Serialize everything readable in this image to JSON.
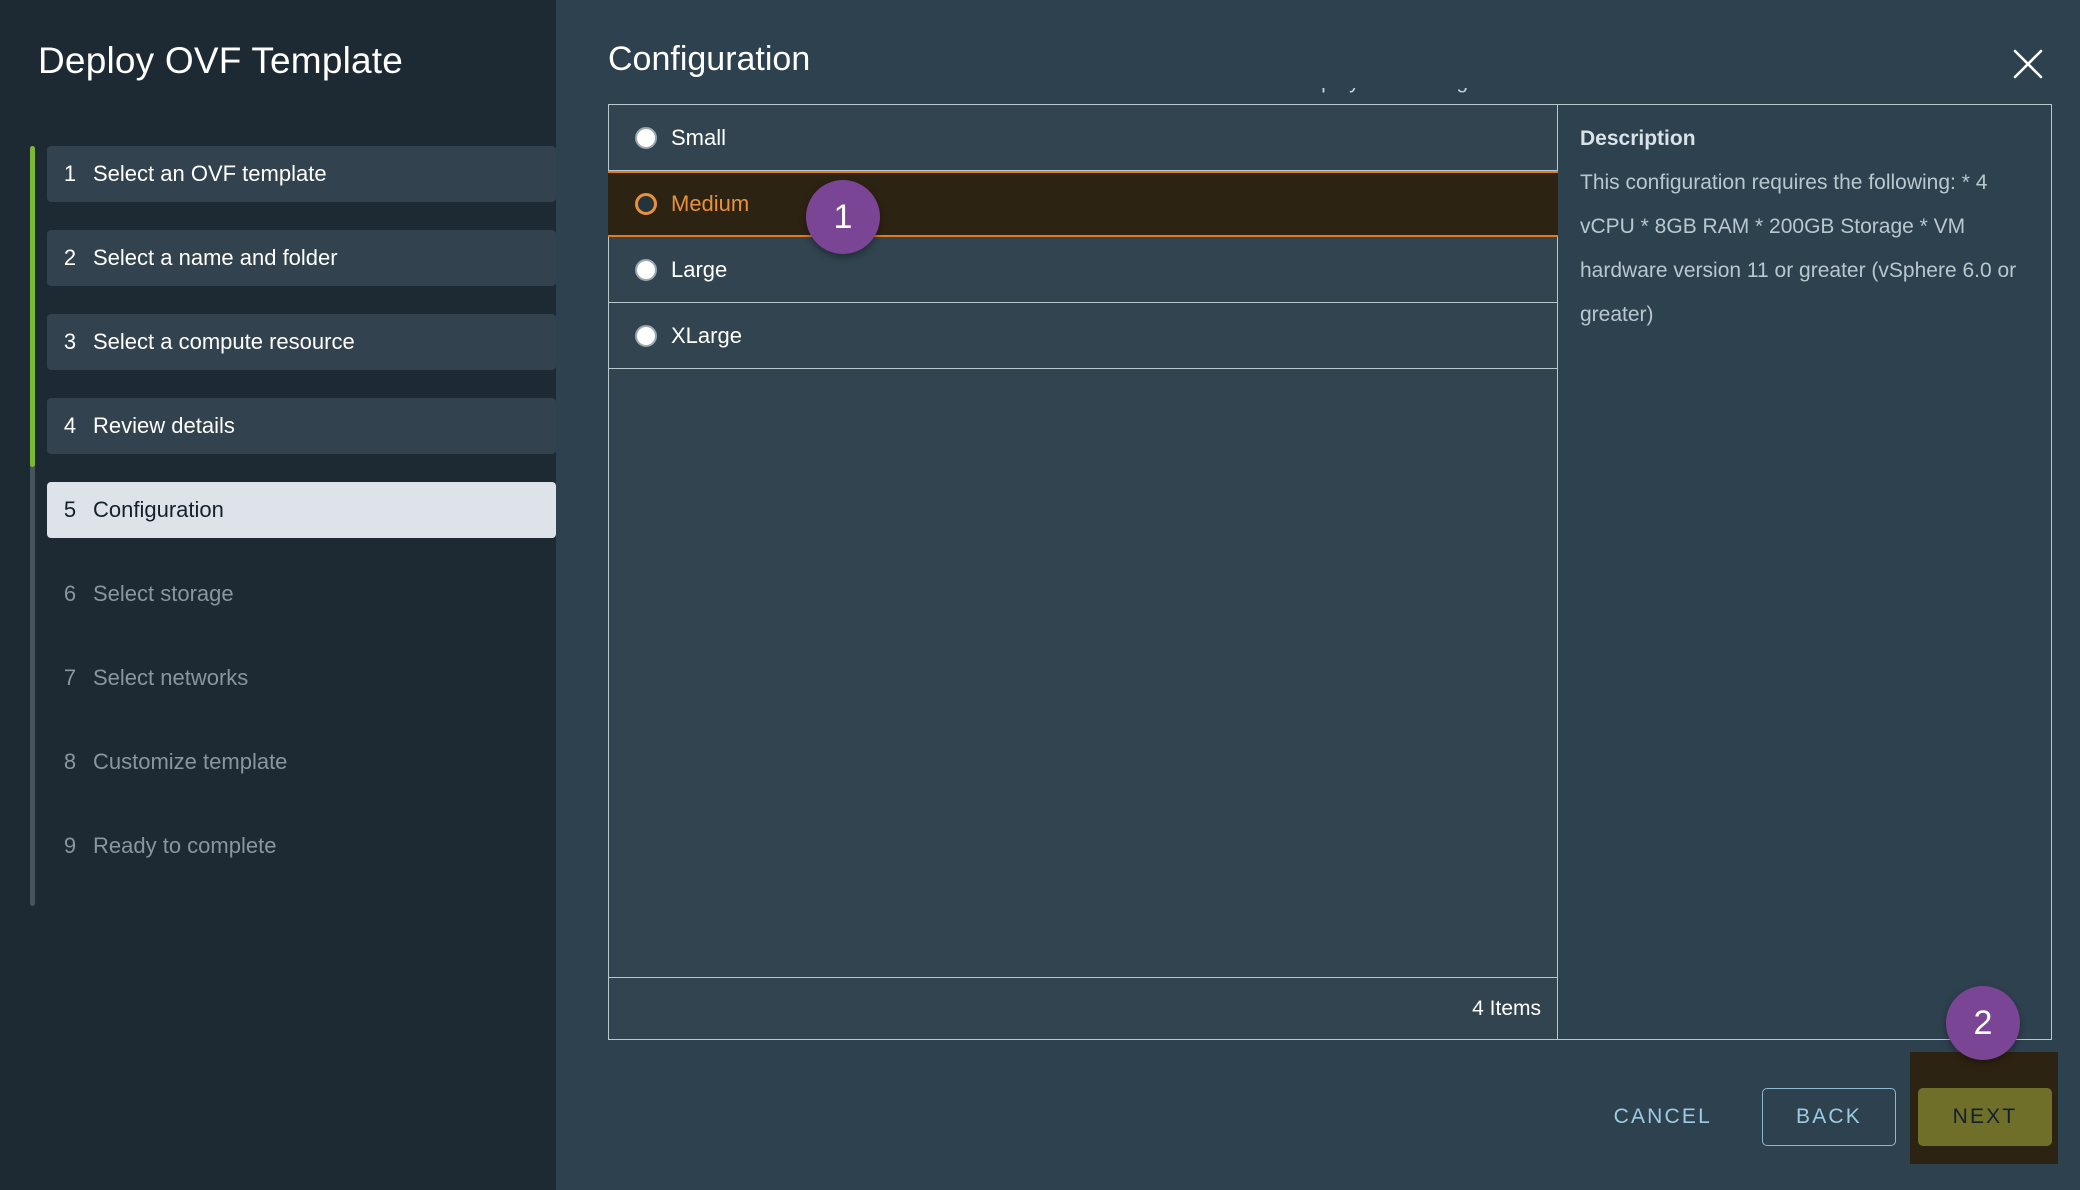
{
  "wizard": {
    "title": "Deploy OVF Template",
    "steps": [
      {
        "num": "1",
        "label": "Select an OVF template",
        "state": "done"
      },
      {
        "num": "2",
        "label": "Select a name and folder",
        "state": "done"
      },
      {
        "num": "3",
        "label": "Select a compute resource",
        "state": "done"
      },
      {
        "num": "4",
        "label": "Review details",
        "state": "done"
      },
      {
        "num": "5",
        "label": "Configuration",
        "state": "active"
      },
      {
        "num": "6",
        "label": "Select storage",
        "state": "pending"
      },
      {
        "num": "7",
        "label": "Select networks",
        "state": "pending"
      },
      {
        "num": "8",
        "label": "Customize template",
        "state": "pending"
      },
      {
        "num": "9",
        "label": "Ready to complete",
        "state": "pending"
      }
    ]
  },
  "page": {
    "title": "Configuration",
    "close_icon": "close-icon",
    "scroll_remnant": "Select a deployment configuration"
  },
  "config_list": {
    "rows": [
      {
        "label": "Small",
        "selected": false
      },
      {
        "label": "Medium",
        "selected": true
      },
      {
        "label": "Large",
        "selected": false
      },
      {
        "label": "XLarge",
        "selected": false
      }
    ],
    "footer_count": "4 Items"
  },
  "description": {
    "heading": "Description",
    "body": "This configuration requires the following: * 4 vCPU * 8GB RAM * 200GB Storage * VM hardware version 11 or greater (vSphere 6.0 or greater)"
  },
  "footer": {
    "cancel_label": "CANCEL",
    "back_label": "BACK",
    "next_label": "NEXT"
  },
  "annotations": {
    "badge_1": "1",
    "badge_2": "2"
  },
  "colors": {
    "sidebar_bg": "#1e2a33",
    "main_bg": "#2e414e",
    "progress_green": "#7cb832",
    "active_step_bg": "#dde3e9",
    "highlight_orange": "#e8913a",
    "highlight_row_bg": "#2d2312",
    "badge_purple": "#7b4595",
    "next_olive": "#6f6f2a",
    "link_blue": "#9ccbe2"
  }
}
